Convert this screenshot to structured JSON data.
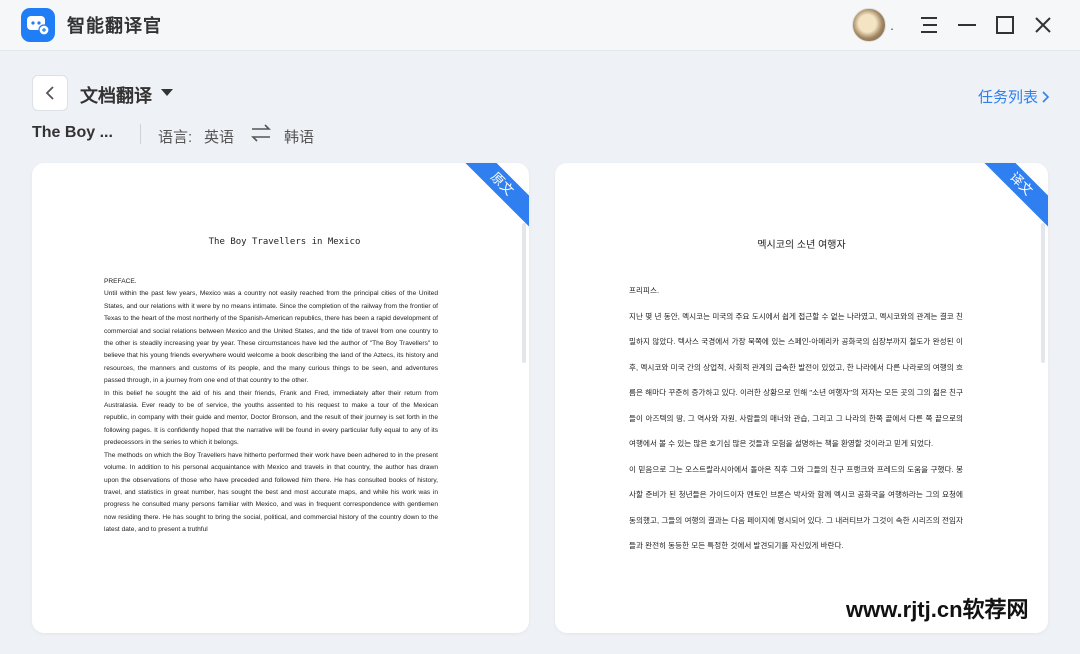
{
  "app": {
    "name": "智能翻译官"
  },
  "window": {
    "avatar_suffix": "."
  },
  "toolbar": {
    "mode": "文档翻译",
    "task_list": "任务列表"
  },
  "file": {
    "name": "The Boy ...",
    "lang_label": "语言:",
    "source_lang": "英语",
    "target_lang": "韩语"
  },
  "source_panel": {
    "ribbon": "原文",
    "title": "The Boy Travellers in Mexico",
    "paragraphs": [
      "PREFACE.",
      "  Until within the past few years, Mexico was a country not easily reached from the principal cities of the United States, and our relations with it were by no means intimate. Since the completion of the railway from the frontier of Texas to the heart of the most northerly of the Spanish-American republics, there has been a rapid development of commercial and social relations between Mexico and the United States, and the tide of travel from one country to the other is steadily increasing year by year. These circumstances have led the author of \"The Boy Travellers\" to believe that his young friends everywhere would welcome a book describing the land of the Aztecs, its history and resources, the manners and customs of its people, and the many curious things to be seen, and adventures passed through, in a journey from one end of that country to the other.",
      "In this belief he sought the aid of his and their friends, Frank and Fred, immediately after their return from Australasia. Ever ready to be of service, the youths assented to his request to make a tour of the Mexican republic, in company with their guide and mentor, Doctor Bronson, and the result of their journey is set forth in the following pages. It is confidently hoped that the narrative will be found in every particular fully equal to any of its predecessors in the series to which it belongs.",
      "The methods on which the Boy Travellers have hitherto performed their work have been adhered to in the present volume. In addition to his personal acquaintance with Mexico and travels in that country, the author has drawn upon the observations of those who have preceded and followed him there. He has consulted books of history, travel, and statistics in great number, has sought the best and most accurate maps, and while his work was in progress he consulted many persons familiar with Mexico, and was in frequent correspondence with gentlemen now residing there. He has sought to bring the social, political, and commercial history of the country down to the latest date, and to present a truthful"
    ]
  },
  "target_panel": {
    "ribbon": "译文",
    "title": "멕시코의 소년 여행자",
    "paragraphs": [
      "프리피스.",
      "지난 몇 년 동안, 멕시코는 미국의 주요 도시에서 쉽게 접근할 수 없는 나라였고, 멕시코와의 관계는 결코 친밀하지 않았다. 텍사스 국경에서 가장 북쪽에 있는 스페인-아메리카 공화국의 심장부까지 철도가 완성된 이후, 멕시코와 미국 간의 상업적, 사회적 관계의 급속한 발전이 있었고, 한 나라에서 다른 나라로의 여행의 흐름은 해마다 꾸준히 증가하고 있다. 이러한 상황으로 인해 \"소년 여행자\"의 저자는 모든 곳의 그의 젊은 친구들이 아즈텍의 땅, 그 역사와 자원, 사람들의 매너와 관습, 그리고 그 나라의 한쪽 끝에서 다른 쪽 끝으로의 여행에서 볼 수 있는 많은 호기심 많은 것들과 모험을 설명하는 책을 환영할 것이라고 믿게 되었다.",
      "이 믿음으로 그는 오스트랄라시아에서 돌아온 직후 그와 그들의 친구 프랭크와 프레드의 도움을 구했다. 봉사할 준비가 된 청년들은 가이드이자 멘토인 브론슨 박사와 함께 멕시코 공화국을 여행하라는 그의 요청에 동의했고, 그들의 여행의 결과는 다음 페이지에 명시되어 있다. 그 내러티브가 그것이 속한 시리즈의 전임자들과 완전히 동등한 모든 특정한 것에서 발견되기를 자신있게 바란다."
    ]
  },
  "watermark": "www.rjtj.cn软荐网"
}
